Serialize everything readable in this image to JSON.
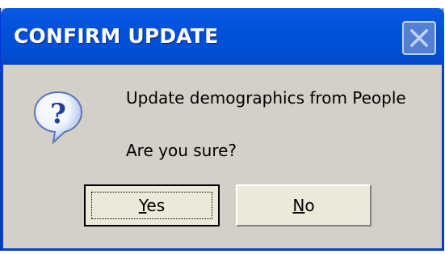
{
  "window": {
    "title": "CONFIRM UPDATE",
    "close_icon": "close-icon"
  },
  "dialog": {
    "icon": "question-icon",
    "message_line1": "Update demographics from People",
    "message_line2": "Are you sure?"
  },
  "buttons": {
    "yes_first": "Y",
    "yes_rest": "es",
    "no_first": "N",
    "no_rest": "o"
  },
  "colors": {
    "titlebar": "#0050d6",
    "body": "#d4d0c8"
  }
}
